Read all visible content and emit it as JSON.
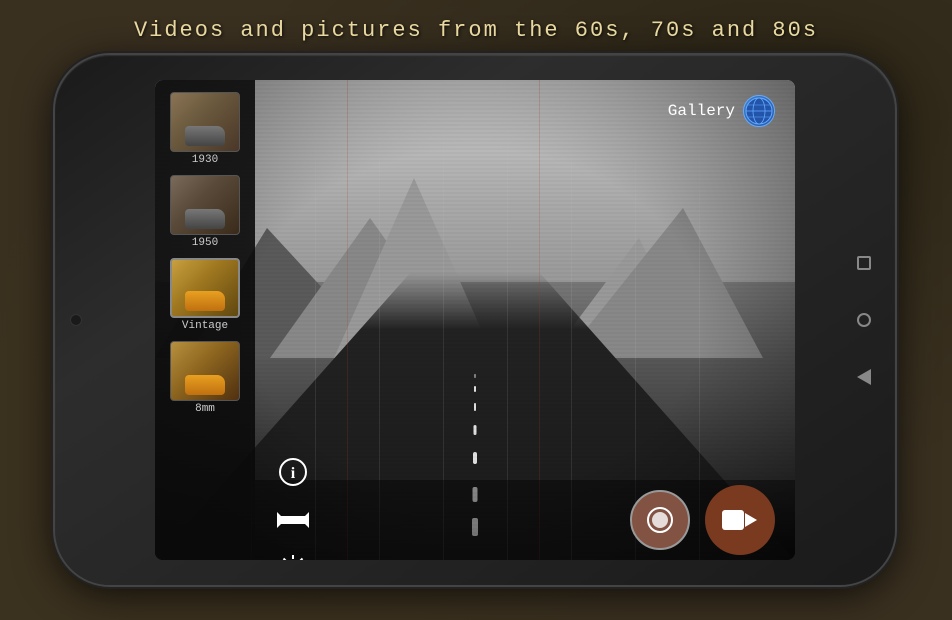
{
  "title": "Videos and pictures from the 60s, 70s and 80s",
  "filters": [
    {
      "id": "1930",
      "label": "1930",
      "active": false,
      "type": "bw"
    },
    {
      "id": "1950",
      "label": "1950",
      "active": false,
      "type": "bw"
    },
    {
      "id": "vintage",
      "label": "Vintage",
      "active": true,
      "type": "color"
    },
    {
      "id": "8mm",
      "label": "8mm",
      "active": false,
      "type": "color"
    }
  ],
  "gallery": {
    "label": "Gallery"
  },
  "controls": {
    "info_icon": "ℹ",
    "flip_icon": "⇔",
    "settings_icon": "⚙",
    "camera_icon": "📷",
    "video_icon": "🎥"
  },
  "nav": {
    "square_label": "recent-apps",
    "circle_label": "home",
    "triangle_label": "back"
  }
}
